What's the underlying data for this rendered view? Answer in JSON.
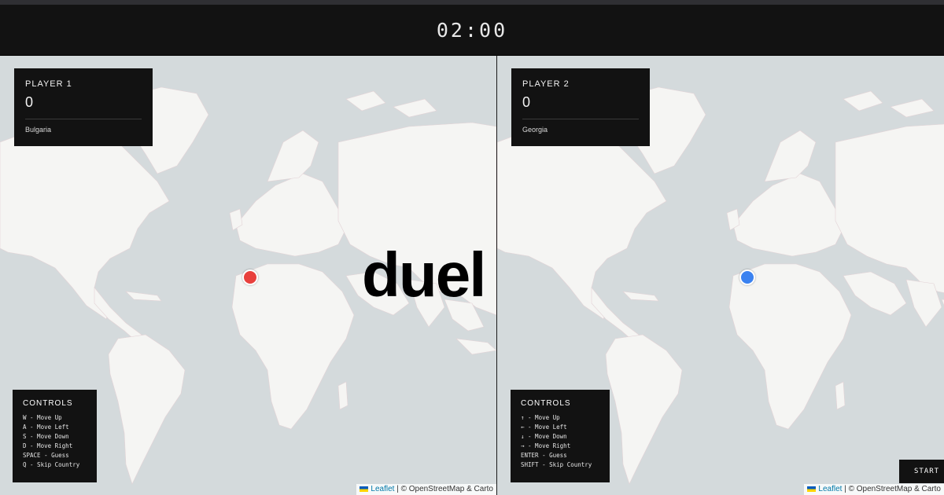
{
  "timer": "02:00",
  "logo": "duel",
  "player1": {
    "name": "PLAYER 1",
    "score": "0",
    "country": "Bulgaria",
    "marker_color": "#e8403c",
    "controls_title": "CONTROLS",
    "controls": [
      "W - Move Up",
      "A - Move Left",
      "S - Move Down",
      "D - Move Right",
      "SPACE - Guess",
      "Q - Skip Country"
    ]
  },
  "player2": {
    "name": "PLAYER 2",
    "score": "0",
    "country": "Georgia",
    "marker_color": "#3b82f0",
    "controls_title": "CONTROLS",
    "controls": [
      "↑ - Move Up",
      "← - Move Left",
      "↓ - Move Down",
      "→ - Move Right",
      "ENTER - Guess",
      "SHIFT - Skip Country"
    ]
  },
  "attribution": {
    "leaflet": "Leaflet",
    "rest_left": " | © OpenStreetMap & Carto",
    "rest_right": " | © OpenStreetMap & Carto"
  },
  "start_label": "START",
  "colors": {
    "ocean": "#d4dadc",
    "land": "#f4f4f2",
    "panel": "#121212"
  }
}
